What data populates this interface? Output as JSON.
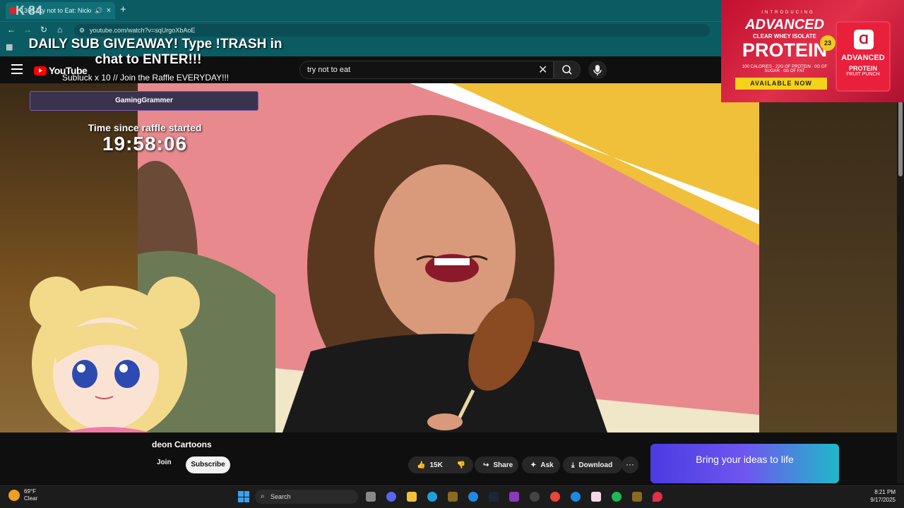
{
  "browser": {
    "tab_title": "1363 Try not to Eat: Nicke",
    "new_tab": "+",
    "url": "youtube.com/watch?v=sqUrgoXbAoE",
    "nav": {
      "back": "←",
      "forward": "→",
      "reload": "↻",
      "home": "⌂"
    }
  },
  "overlay": {
    "corner_logo": "K 84",
    "giveaway_line1": "DAILY SUB GIVEAWAY! Type !TRASH in",
    "giveaway_line2": "chat to ENTER!!!",
    "subluck": "Subluck x 10 // Join the Raffle EVERYDAY!!!",
    "winner": "GamingGrammer",
    "raffle_label": "Time since raffle started",
    "raffle_time": "19:58:06"
  },
  "youtube": {
    "logo": "YouTube",
    "search_value": "try not to eat",
    "channel_name": "deon Cartoons",
    "join": "Join",
    "subscribe": "Subscribe",
    "likes": "15K",
    "share": "Share",
    "ask": "Ask",
    "download": "Download",
    "more": "···",
    "promo": "Bring your ideas to life"
  },
  "ad": {
    "intro": "INTRODUCING",
    "advanced": "ADVANCED",
    "sub": "CLEAR WHEY ISOLATE",
    "protein": "PROTEIN",
    "badge": "23",
    "nums": "100 CALORIES · 22G OF PROTEIN · 0G OF SUGAR · 0G OF FAT",
    "cta": "AVAILABLE NOW",
    "tub_brand": "ADVANCED",
    "tub_name": "PROTEIN",
    "tub_flavor": "FRUIT PUNCH"
  },
  "taskbar": {
    "temp": "69°F",
    "condition": "Clear",
    "search": "Search",
    "time": "8:21 PM",
    "date": "9/17/2025"
  }
}
